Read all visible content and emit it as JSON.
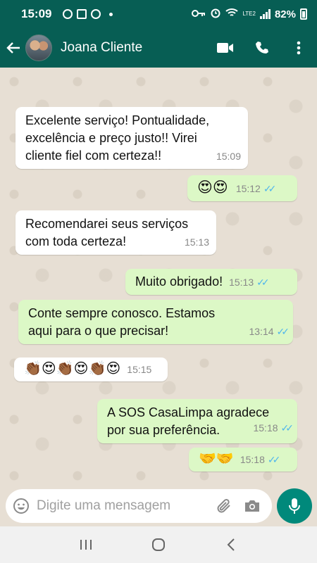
{
  "status_bar": {
    "time": "15:09",
    "battery": "82%",
    "network": "LTE2"
  },
  "header": {
    "contact_name": "Joana Cliente"
  },
  "messages": [
    {
      "direction": "in",
      "text": "Excelente serviço! Pontualidade, excelência e preço justo!! Virei cliente fiel com certeza!!",
      "time": "15:09"
    },
    {
      "direction": "out",
      "text": "😍😍",
      "time": "15:12",
      "status": "read"
    },
    {
      "direction": "in",
      "text": "Recomendarei seus serviços com toda certeza!",
      "time": "15:13"
    },
    {
      "direction": "out",
      "text": "Muito obrigado!",
      "time": "15:13",
      "status": "read"
    },
    {
      "direction": "out",
      "text": "Conte sempre conosco. Estamos aqui para o que precisar!",
      "time": "13:14",
      "status": "read"
    },
    {
      "direction": "in",
      "text": "👏🏾😍👏🏾😍👏🏾😍",
      "time": "15:15"
    },
    {
      "direction": "out",
      "text": "A SOS CasaLimpa agradece por sua preferência.",
      "time": "15:18",
      "status": "read"
    },
    {
      "direction": "out",
      "text": "🤝🤝",
      "time": "15:18",
      "status": "read"
    }
  ],
  "input": {
    "placeholder": "Digite uma mensagem"
  },
  "icons": {
    "back": "arrow-left-icon",
    "video": "video-call-icon",
    "call": "phone-icon",
    "menu": "more-vert-icon",
    "emoji": "emoji-icon",
    "attach": "paperclip-icon",
    "camera": "camera-icon",
    "mic": "mic-icon",
    "nav_recent": "recents-icon",
    "nav_home": "home-icon",
    "nav_back": "back-icon"
  },
  "colors": {
    "header": "#075e54",
    "outgoing_bubble": "#dcf8c6",
    "incoming_bubble": "#ffffff",
    "read_ticks": "#4fb6ec",
    "mic_button": "#00897b"
  }
}
